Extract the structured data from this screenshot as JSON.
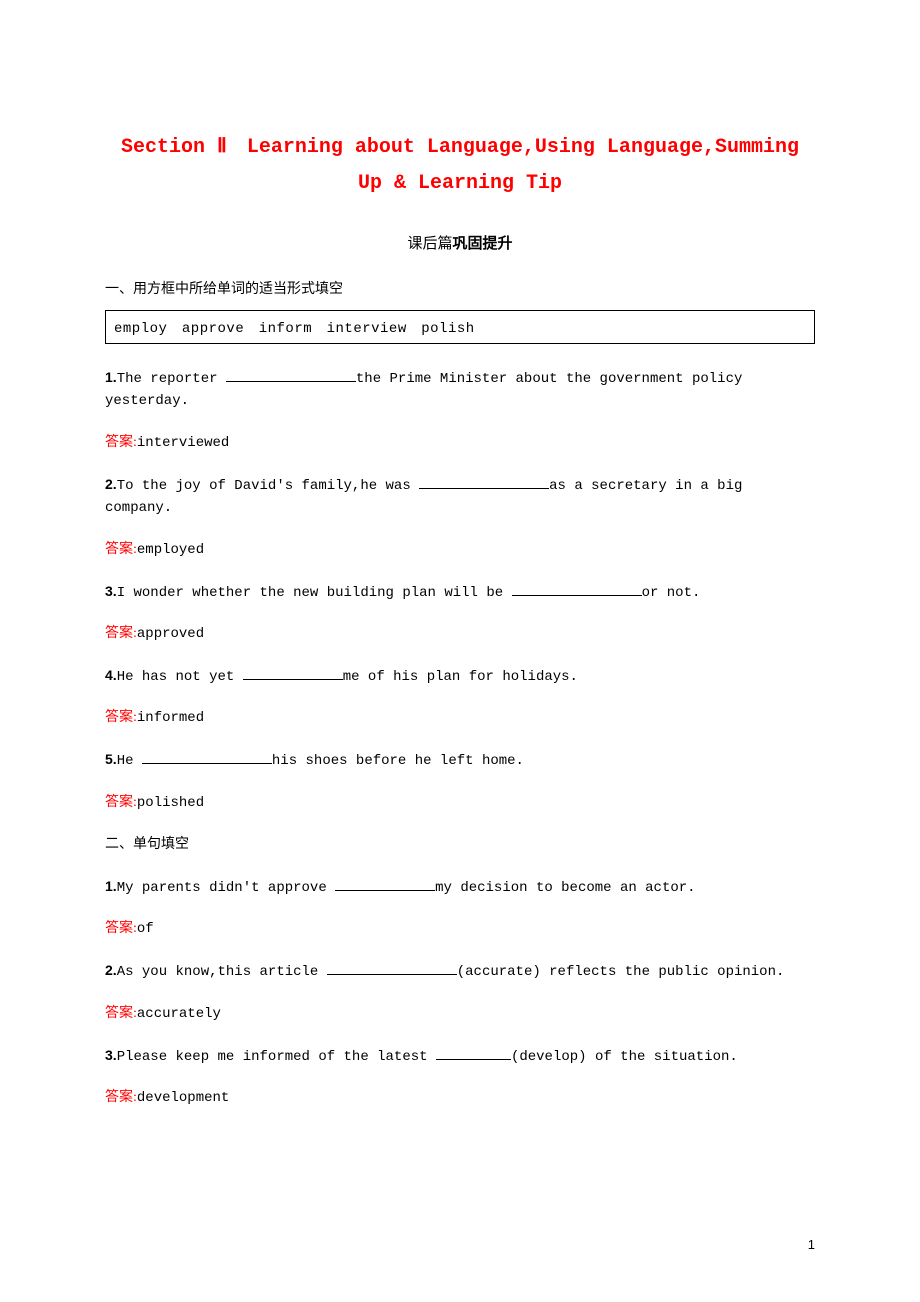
{
  "title": "Section Ⅱ　Learning about Language,Using Language,Summing Up & Learning Tip",
  "subtitle_prefix": "课后篇",
  "subtitle_bold": "巩固提升",
  "section1_heading": "一、用方框中所给单词的适当形式填空",
  "word_box": "employ　approve　inform　interview　polish",
  "answer_label": "答案:",
  "q1": {
    "num": "1.",
    "before": "The reporter ",
    "after": "the Prime Minister about the government policy yesterday.",
    "answer": "interviewed"
  },
  "q2": {
    "num": "2.",
    "before": "To the joy of David's family,he was ",
    "after": "as a secretary in a big company.",
    "answer": "employed"
  },
  "q3": {
    "num": "3.",
    "before": "I wonder whether the new building plan will be ",
    "after": "or not.",
    "answer": "approved"
  },
  "q4": {
    "num": "4.",
    "before": "He has not yet ",
    "after": "me of his plan for holidays.",
    "answer": "informed"
  },
  "q5": {
    "num": "5.",
    "before": "He ",
    "after": "his shoes before he left home.",
    "answer": "polished"
  },
  "section2_heading": "二、单句填空",
  "s2q1": {
    "num": "1.",
    "before": "My parents didn't approve ",
    "after": "my decision to become an actor.",
    "answer": "of"
  },
  "s2q2": {
    "num": "2.",
    "before": "As you know,this article ",
    "hint": "(accurate) reflects the public opinion.",
    "answer": "accurately"
  },
  "s2q3": {
    "num": "3.",
    "before": "Please keep me informed of the latest ",
    "hint": "(develop) of the situation.",
    "answer": "development"
  },
  "page_number": "1"
}
